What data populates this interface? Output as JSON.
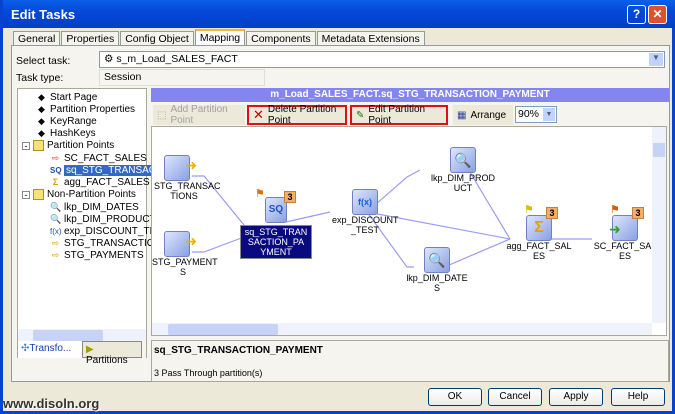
{
  "window": {
    "title": "Edit Tasks"
  },
  "tabs": [
    "General",
    "Properties",
    "Config Object",
    "Mapping",
    "Components",
    "Metadata Extensions"
  ],
  "active_tab": "Mapping",
  "select_task": {
    "label": "Select task:",
    "value": "s_m_Load_SALES_FACT"
  },
  "task_type": {
    "label": "Task type:",
    "value": "Session"
  },
  "tree": {
    "items": [
      "Start Page",
      "Partition Properties",
      "KeyRange",
      "HashKeys"
    ],
    "partition_points": {
      "label": "Partition Points",
      "children": [
        "SC_FACT_SALES",
        "sq_STG_TRANSACTIO",
        "agg_FACT_SALES"
      ]
    },
    "non_partition_points": {
      "label": "Non-Partition Points",
      "children": [
        "lkp_DIM_DATES",
        "lkp_DIM_PRODUCT",
        "exp_DISCOUNT_TEST",
        "STG_TRANSACTIONS",
        "STG_PAYMENTS"
      ]
    }
  },
  "left_tabs": [
    "Transfo...",
    "Partitions"
  ],
  "header": "m_Load_SALES_FACT.sq_STG_TRANSACTION_PAYMENT",
  "toolbar": {
    "add": "Add Partition Point",
    "delete": "Delete Partition Point",
    "edit": "Edit Partition Point",
    "arrange": "Arrange",
    "zoom": "90%"
  },
  "nodes": {
    "stg_trans": "STG_TRANSAC TIONS",
    "stg_pay": "STG_PAYMENT S",
    "sq": "sq_STG_TRAN SACTION_PA YMENT",
    "exp": "exp_DISCOUNT _TEST",
    "lkp_prod": "lkp_DIM_PROD UCT",
    "lkp_dates": "lkp_DIM_DATE S",
    "agg": "agg_FACT_SAL ES",
    "sc": "SC_FACT_SAL ES",
    "sq_partitions": "3",
    "agg_partitions": "3",
    "sc_partitions": "3"
  },
  "info": {
    "name": "sq_STG_TRANSACTION_PAYMENT",
    "detail": "3 Pass Through partition(s)"
  },
  "buttons": {
    "ok": "OK",
    "cancel": "Cancel",
    "apply": "Apply",
    "help": "Help"
  },
  "watermark": "www.disoln.org"
}
